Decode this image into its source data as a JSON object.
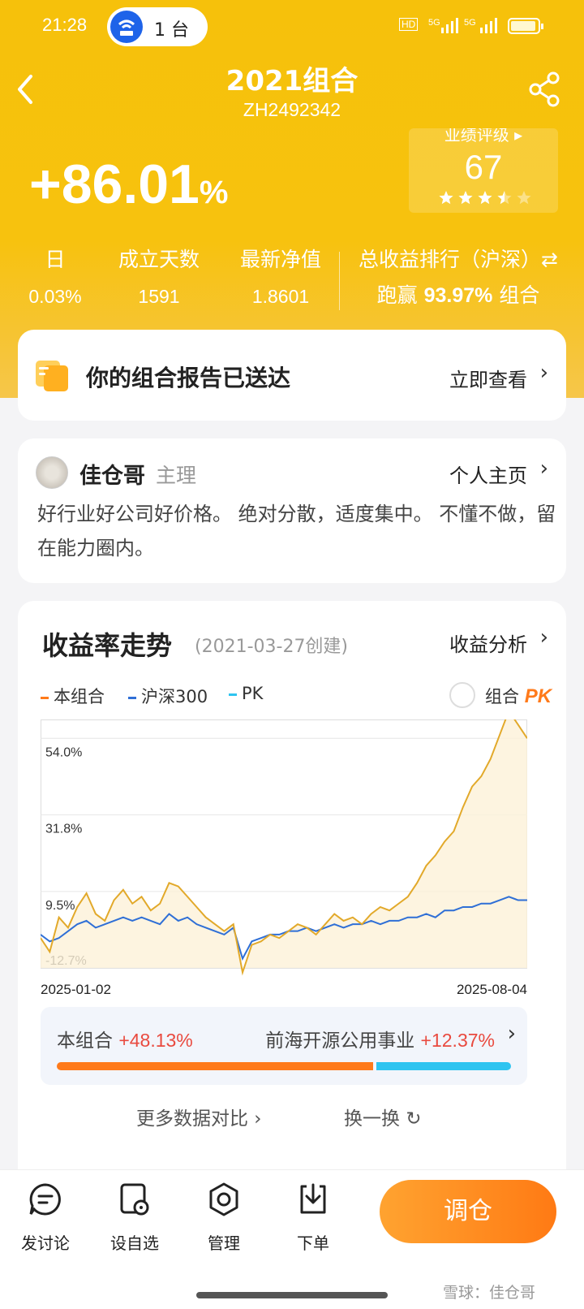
{
  "status_bar": {
    "time": "21:28",
    "hotspot_label": "1 台",
    "hd": "HD",
    "sig1": "5G",
    "sig2": "5G"
  },
  "header": {
    "title": "2021组合",
    "code": "ZH2492342"
  },
  "summary": {
    "total_return": "+86.01",
    "total_return_unit": "%",
    "rating_label": "业绩评级 ▸",
    "rating_value": "67",
    "rating_stars": 3.5
  },
  "stats": [
    {
      "label": "日",
      "value": "0.03%"
    },
    {
      "label": "成立天数",
      "value": "1591"
    },
    {
      "label": "最新净值",
      "value": "1.8601"
    }
  ],
  "ranking": {
    "label": "总收益排行（沪深）⇄",
    "prefix": "跑赢",
    "value": "93.97%",
    "suffix": "组合"
  },
  "report_card": {
    "title": "你的组合报告已送达",
    "link": "立即查看"
  },
  "manager": {
    "name": "佳仓哥",
    "role": "主理",
    "link": "个人主页",
    "bio": "好行业好公司好价格。 绝对分散，适度集中。 不懂不做，留在能力圈内。"
  },
  "chart_section": {
    "title": "收益率走势",
    "created": "(2021-03-27创建)",
    "link": "收益分析",
    "legend": [
      {
        "name": "本组合",
        "color": "#ff7a1a"
      },
      {
        "name": "沪深300",
        "color": "#2f6fd6"
      },
      {
        "name": "PK",
        "color": "#2ec4f0"
      }
    ],
    "pk_label": "组合",
    "pk_mark": "PK",
    "more_link": "更多数据对比",
    "swap_link": "换一换"
  },
  "chart_data": {
    "type": "line",
    "x_start": "2025-01-02",
    "x_end": "2025-08-04",
    "y_ticks": [
      "54.0%",
      "31.8%",
      "9.5%",
      "-12.7%"
    ],
    "y_tick_values": [
      54.0,
      31.8,
      9.5,
      -12.7
    ],
    "ylim": [
      -12.7,
      59.5
    ],
    "grid": true,
    "series": [
      {
        "name": "本组合",
        "color": "#e2a92a",
        "values": [
          -4,
          -8,
          2,
          -1,
          5,
          9,
          3,
          1,
          7,
          10,
          6,
          8,
          4,
          6,
          12,
          11,
          8,
          5,
          2,
          0,
          -2,
          0,
          -14,
          -6,
          -5,
          -3,
          -4,
          -2,
          0,
          -1,
          -3,
          0,
          3,
          1,
          2,
          0,
          3,
          5,
          4,
          6,
          8,
          12,
          17,
          20,
          24,
          27,
          34,
          40,
          43,
          48,
          55,
          62,
          58,
          54
        ]
      },
      {
        "name": "沪深300",
        "color": "#2f6fd6",
        "values": [
          -3,
          -5,
          -4,
          -2,
          0,
          1,
          -1,
          0,
          1,
          2,
          1,
          2,
          1,
          0,
          3,
          1,
          2,
          0,
          -1,
          -2,
          -3,
          -1,
          -10,
          -5,
          -4,
          -3,
          -3,
          -2,
          -2,
          -1,
          -2,
          -1,
          0,
          -1,
          0,
          0,
          1,
          0,
          1,
          1,
          2,
          2,
          3,
          2,
          4,
          4,
          5,
          5,
          6,
          6,
          7,
          8,
          7,
          7
        ]
      }
    ]
  },
  "comparison": {
    "a_label": "本组合",
    "a_value": "+48.13%",
    "b_label": "前海开源公用事业",
    "b_value": "+12.37%",
    "a_share": 0.7
  },
  "tabbar": {
    "items": [
      {
        "label": "发讨论",
        "icon": "chat-icon"
      },
      {
        "label": "设自选",
        "icon": "watchlist-icon"
      },
      {
        "label": "管理",
        "icon": "manage-icon"
      },
      {
        "label": "下单",
        "icon": "order-icon"
      }
    ],
    "cta": "调仓",
    "watermark": "雪球：佳仓哥"
  }
}
